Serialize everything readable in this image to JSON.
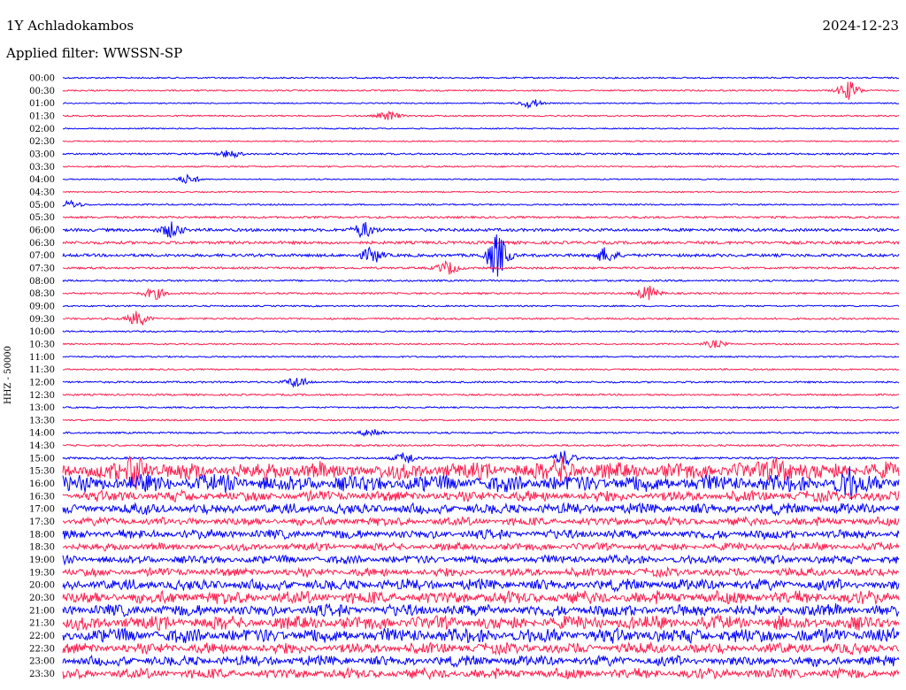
{
  "header": {
    "station": "1Y Achladokambos",
    "date": "2024-12-23",
    "filter": "Applied filter: WWSSN-SP"
  },
  "chart_data": {
    "type": "line",
    "title": "1Y Achladokambos",
    "ylabel": "HHZ - 50000",
    "row_labels": [
      "00:00",
      "00:30",
      "01:00",
      "01:30",
      "02:00",
      "02:30",
      "03:00",
      "03:30",
      "04:00",
      "04:30",
      "05:00",
      "05:30",
      "06:00",
      "06:30",
      "07:00",
      "07:30",
      "08:00",
      "08:30",
      "09:00",
      "09:30",
      "10:00",
      "10:30",
      "11:00",
      "11:30",
      "12:00",
      "12:30",
      "13:00",
      "13:30",
      "14:00",
      "14:30",
      "15:00",
      "15:30",
      "16:00",
      "16:30",
      "17:00",
      "17:30",
      "18:00",
      "18:30",
      "19:00",
      "19:30",
      "20:00",
      "20:30",
      "21:00",
      "21:30",
      "22:00",
      "22:30",
      "23:00",
      "23:30"
    ],
    "row_noise_level": [
      0.5,
      0.5,
      0.4,
      0.5,
      0.4,
      0.4,
      0.6,
      0.5,
      0.4,
      0.4,
      0.5,
      0.7,
      1.0,
      1.0,
      1.0,
      0.7,
      0.6,
      0.6,
      0.5,
      0.6,
      0.5,
      0.5,
      0.5,
      0.5,
      0.6,
      0.6,
      0.5,
      0.5,
      0.6,
      0.6,
      0.7,
      4.0,
      4.0,
      2.5,
      2.5,
      2.0,
      2.2,
      1.8,
      2.0,
      2.0,
      2.6,
      3.0,
      2.8,
      3.2,
      3.4,
      2.6,
      2.4,
      2.4
    ],
    "events": [
      {
        "row": 1,
        "x": 0.94,
        "amp": 10
      },
      {
        "row": 2,
        "x": 0.56,
        "amp": 5
      },
      {
        "row": 3,
        "x": 0.39,
        "amp": 5
      },
      {
        "row": 6,
        "x": 0.2,
        "amp": 4
      },
      {
        "row": 8,
        "x": 0.15,
        "amp": 5
      },
      {
        "row": 10,
        "x": 0.01,
        "amp": 4
      },
      {
        "row": 12,
        "x": 0.13,
        "amp": 8
      },
      {
        "row": 12,
        "x": 0.36,
        "amp": 8
      },
      {
        "row": 14,
        "x": 0.52,
        "amp": 24
      },
      {
        "row": 14,
        "x": 0.37,
        "amp": 8
      },
      {
        "row": 14,
        "x": 0.65,
        "amp": 8
      },
      {
        "row": 15,
        "x": 0.46,
        "amp": 7
      },
      {
        "row": 17,
        "x": 0.11,
        "amp": 6
      },
      {
        "row": 17,
        "x": 0.7,
        "amp": 8
      },
      {
        "row": 19,
        "x": 0.09,
        "amp": 8
      },
      {
        "row": 21,
        "x": 0.78,
        "amp": 4
      },
      {
        "row": 24,
        "x": 0.28,
        "amp": 6
      },
      {
        "row": 28,
        "x": 0.37,
        "amp": 5
      },
      {
        "row": 30,
        "x": 0.41,
        "amp": 6
      },
      {
        "row": 30,
        "x": 0.6,
        "amp": 8
      },
      {
        "row": 31,
        "x": 0.09,
        "amp": 16
      },
      {
        "row": 31,
        "x": 0.6,
        "amp": 10
      },
      {
        "row": 31,
        "x": 0.86,
        "amp": 12
      },
      {
        "row": 32,
        "x": 0.94,
        "amp": 12
      }
    ],
    "colors": [
      "#0000ff",
      "#ff1e4e"
    ]
  }
}
